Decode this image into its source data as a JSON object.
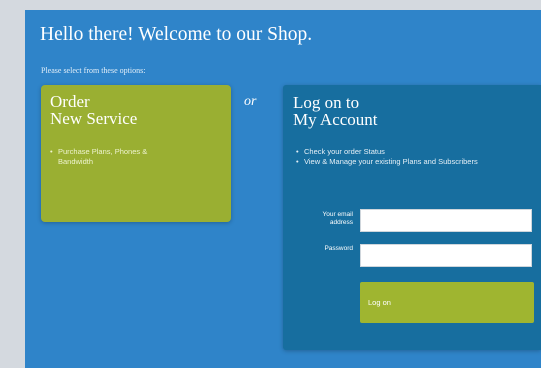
{
  "page": {
    "title": "Hello there! Welcome to our Shop.",
    "subtitle": "Please select from these options:",
    "connector": "or"
  },
  "order_card": {
    "heading_line1": "Order",
    "heading_line2": "New Service",
    "items": [
      "Purchase Plans, Phones & Bandwidth"
    ]
  },
  "logon_card": {
    "heading_line1": "Log on to",
    "heading_line2": "My Account",
    "items": [
      "Check your order Status",
      "View & Manage your existing Plans and Subscribers"
    ],
    "email_label": "Your email address",
    "email_value": "",
    "password_label": "Password",
    "password_value": "",
    "button_label": "Log on"
  },
  "colors": {
    "background": "#2f84c9",
    "accent_green": "#9aaf32",
    "logon_panel": "#176e9f"
  }
}
